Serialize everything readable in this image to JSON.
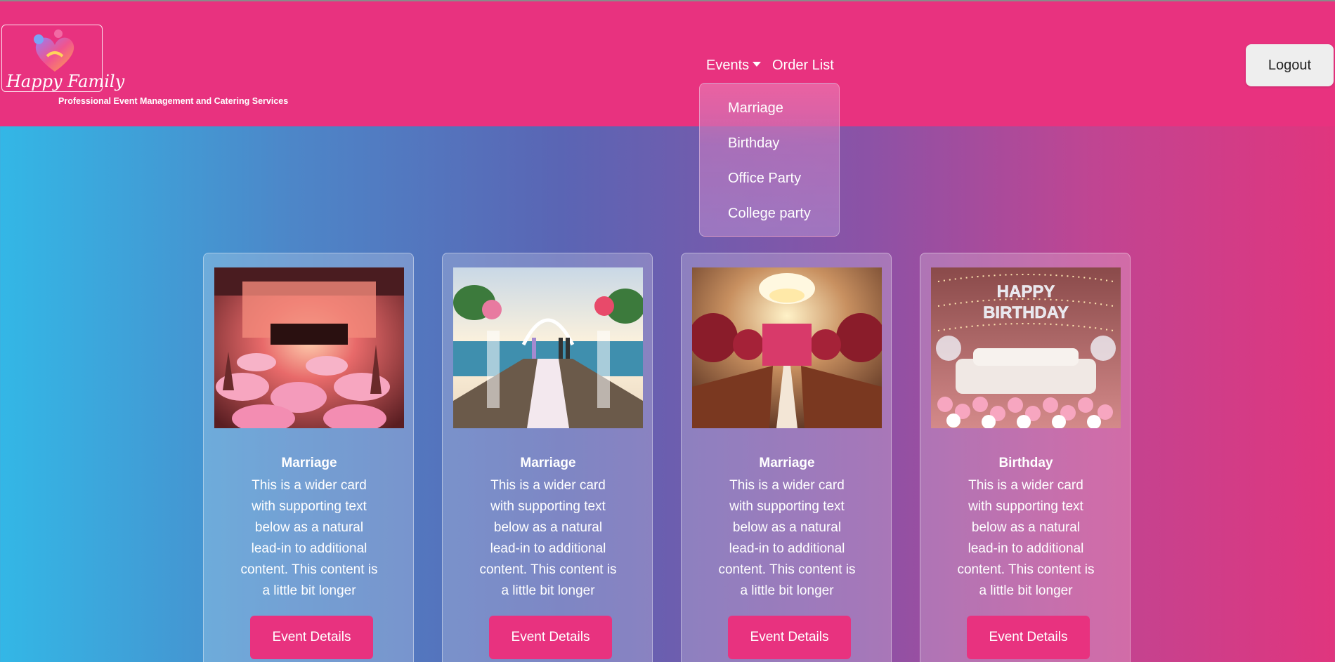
{
  "brand": {
    "name": "Happy Family",
    "tagline": "Professional Event Management and Catering Services",
    "logo_icon": "heart-family-logo"
  },
  "nav": {
    "events_label": "Events",
    "orders_label": "Order List",
    "logout_label": "Logout"
  },
  "events_menu": [
    "Marriage",
    "Birthday",
    "Office Party",
    "College party"
  ],
  "cards": [
    {
      "title": "Marriage",
      "text": "This is a wider card with supporting text below as a natural lead-in to additional content. This content is a little bit longer",
      "button": "Event Details",
      "image": "wedding-hall-photo"
    },
    {
      "title": "Marriage",
      "text": "This is a wider card with supporting text below as a natural lead-in to additional content. This content is a little bit longer",
      "button": "Event Details",
      "image": "beach-wedding-photo"
    },
    {
      "title": "Marriage",
      "text": "This is a wider card with supporting text below as a natural lead-in to additional content. This content is a little bit longer",
      "button": "Event Details",
      "image": "chandelier-wedding-photo"
    },
    {
      "title": "Birthday",
      "text": "This is a wider card with supporting text below as a natural lead-in to additional content. This content is a little bit longer",
      "button": "Event Details",
      "image": "birthday-balloons-photo"
    }
  ],
  "colors": {
    "header": "#e8327f",
    "button": "#e8327f",
    "gradient_start": "#33b7e6",
    "gradient_end": "#e0357e"
  }
}
